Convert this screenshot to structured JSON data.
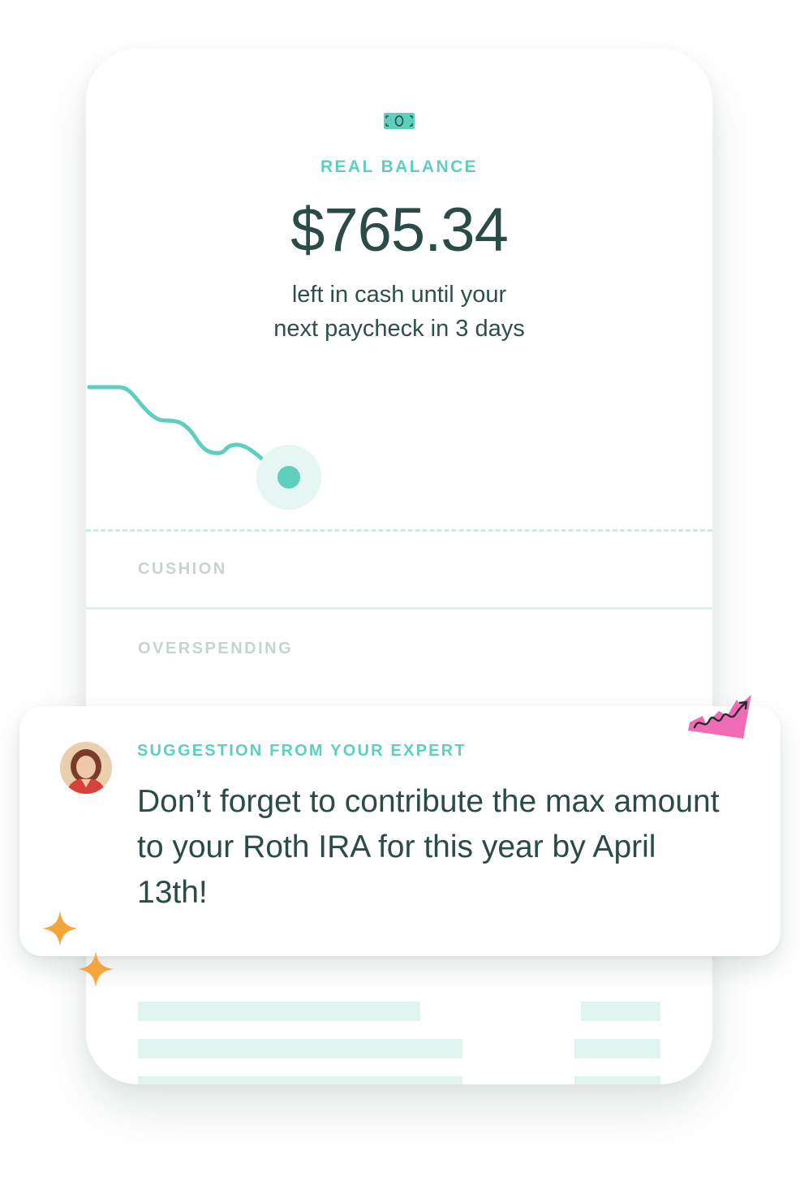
{
  "balance": {
    "label": "REAL BALANCE",
    "amount": "$765.34",
    "subtext_line1": "left in cash until your",
    "subtext_line2": "next paycheck in 3 days"
  },
  "zones": {
    "cushion": "CUSHION",
    "overspending": "OVERSPENDING"
  },
  "suggestion": {
    "eyebrow": "SUGGESTION FROM YOUR EXPERT",
    "message": "Don’t forget to contribute the max amount to your Roth IRA for this year by April 13th!"
  },
  "colors": {
    "accent": "#5fcfbd",
    "text": "#2b4b47",
    "muted": "#c7d3d1",
    "sparkle": "#f5a53a",
    "sticker": "#f06bb5"
  },
  "icons": {
    "balance": "money-bill-icon",
    "sticker": "squiggle-sticker-icon",
    "sparkle": "sparkle-icon"
  }
}
